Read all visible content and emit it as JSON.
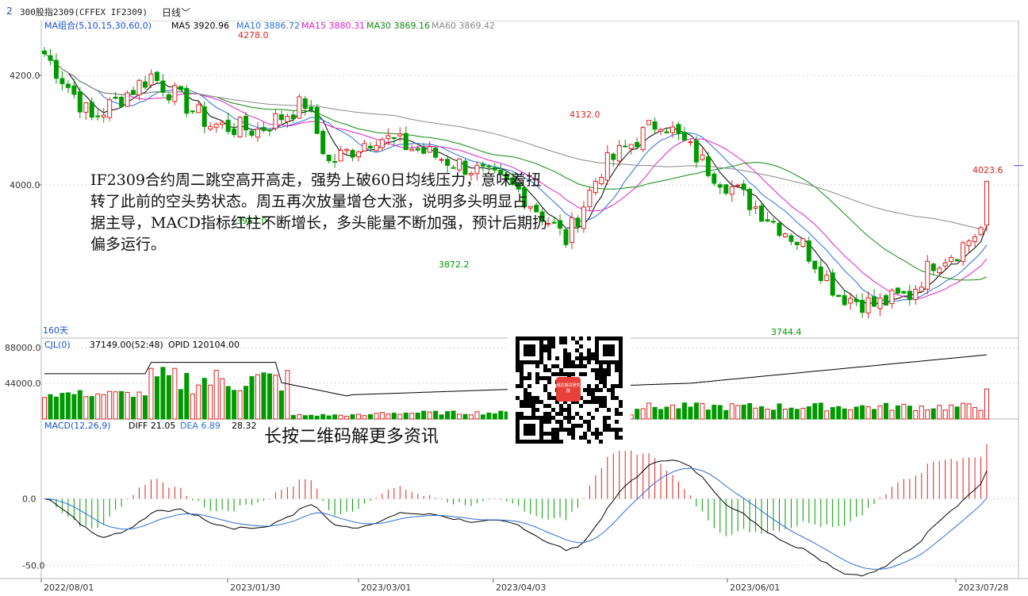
{
  "header": {
    "index": "2",
    "symbol": "300股指2309(CFFEX IF2309)",
    "period": "日线"
  },
  "overlay": {
    "text_lines": [
      "IF2309合约周二跳空高开高走，强势上破60日均线压力，意味着扭",
      "转了此前的空头势状态。周五再次放量增仓大涨，说明多头明显占",
      "据主导，MACD指标红柱不断增长，多头能量不断加强，预计后期扔",
      "偏多运行。"
    ],
    "qr_caption": "长按二维码解更多资讯",
    "qr_logo": "城达期货研究院"
  },
  "chart_data": [
    {
      "type": "candlestick",
      "title": "",
      "legend": {
        "group_label": "MA组合(5,10,15,30,60,0)",
        "items": [
          {
            "name": "MA5",
            "value": "3920.96",
            "color": "#000000"
          },
          {
            "name": "MA10",
            "value": "3886.72",
            "color": "#2a6fd6"
          },
          {
            "name": "MA15",
            "value": "3880.31",
            "color": "#e020c8"
          },
          {
            "name": "MA30",
            "value": "3869.16",
            "color": "#108a10"
          },
          {
            "name": "MA60",
            "value": "3869.42",
            "color": "#8a8a8a"
          }
        ]
      },
      "y_ticks": [
        "4200.0",
        "4000.0"
      ],
      "ylim": [
        3720,
        4300
      ],
      "period_label": "160天",
      "annotations": [
        {
          "label": "4278.0",
          "value": 4278.0,
          "kind": "high"
        },
        {
          "label": "4132.0",
          "value": 4132.0,
          "kind": "high"
        },
        {
          "label": "4023.6",
          "value": 4023.6,
          "kind": "high"
        },
        {
          "label": "3872.2",
          "value": 3872.2,
          "kind": "low"
        },
        {
          "label": "3744.4",
          "value": 3744.4,
          "kind": "low"
        },
        {
          "label": "3957.0",
          "value": 3957.0,
          "kind": "low"
        }
      ],
      "x_ticks": [
        "2022/08/01",
        "2023/01/30",
        "2023/03/01",
        "2023/04/03",
        "2023/06/01",
        "2023/07/28"
      ],
      "colors": {
        "up": "#e02020",
        "down": "#009a00"
      }
    },
    {
      "type": "bar",
      "legend": {
        "label": "CJL(0)",
        "volume_text": "37149.00(52:48)",
        "opid_text": "OPID 120104.00"
      },
      "y_ticks": [
        "88000.0",
        "44000.0"
      ],
      "ylim": [
        0,
        100000
      ]
    },
    {
      "type": "line",
      "legend": {
        "label": "MACD(12,26,9)",
        "items": [
          {
            "name": "DIFF",
            "value": "21.05",
            "color": "#000000"
          },
          {
            "name": "DEA",
            "value": "6.89",
            "color": "#2a6fd6"
          },
          {
            "name": "",
            "value": "28.32",
            "color": "#000000"
          }
        ]
      },
      "y_ticks": [
        "0.0",
        "-50.0"
      ],
      "ylim": [
        -60,
        60
      ]
    }
  ]
}
